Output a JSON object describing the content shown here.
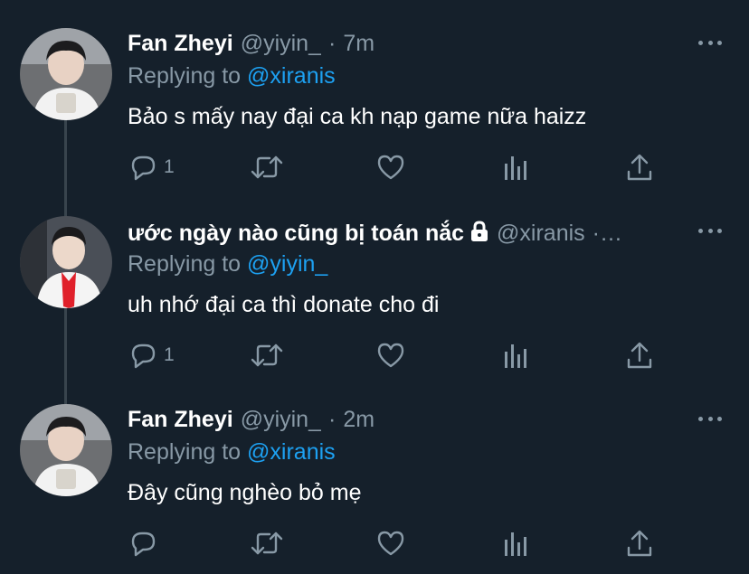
{
  "tweets": [
    {
      "name": "Fan Zheyi",
      "handle": "@yiyin_",
      "separator": "·",
      "time": "7m",
      "replying_prefix": "Replying to",
      "replying_to": "@xiranis",
      "text": "Bảo s mấy nay đại ca kh nạp game nữa haizz",
      "reply_count": "1",
      "locked": false,
      "avatar": "boy-white-shirt-avatar"
    },
    {
      "name": "ước ngày nào cũng bị toán nắc",
      "handle": "@xiranis",
      "separator": "·…",
      "time": "",
      "replying_prefix": "Replying to",
      "replying_to": "@yiyin_",
      "text": "uh nhớ đại ca thì donate cho đi",
      "reply_count": "1",
      "locked": true,
      "avatar": "boy-red-scarf-avatar"
    },
    {
      "name": "Fan Zheyi",
      "handle": "@yiyin_",
      "separator": "·",
      "time": "2m",
      "replying_prefix": "Replying to",
      "replying_to": "@xiranis",
      "text": "Đây cũng nghèo bỏ mẹ",
      "reply_count": "",
      "locked": false,
      "avatar": "boy-white-shirt-avatar"
    }
  ],
  "colors": {
    "background": "#15202b",
    "text": "#ffffff",
    "secondary": "#8899a6",
    "accent": "#1da1f2",
    "thread_line": "#38444d"
  },
  "icons": [
    "reply-icon",
    "retweet-icon",
    "like-icon",
    "analytics-icon",
    "share-icon",
    "more-icon",
    "lock-icon"
  ]
}
